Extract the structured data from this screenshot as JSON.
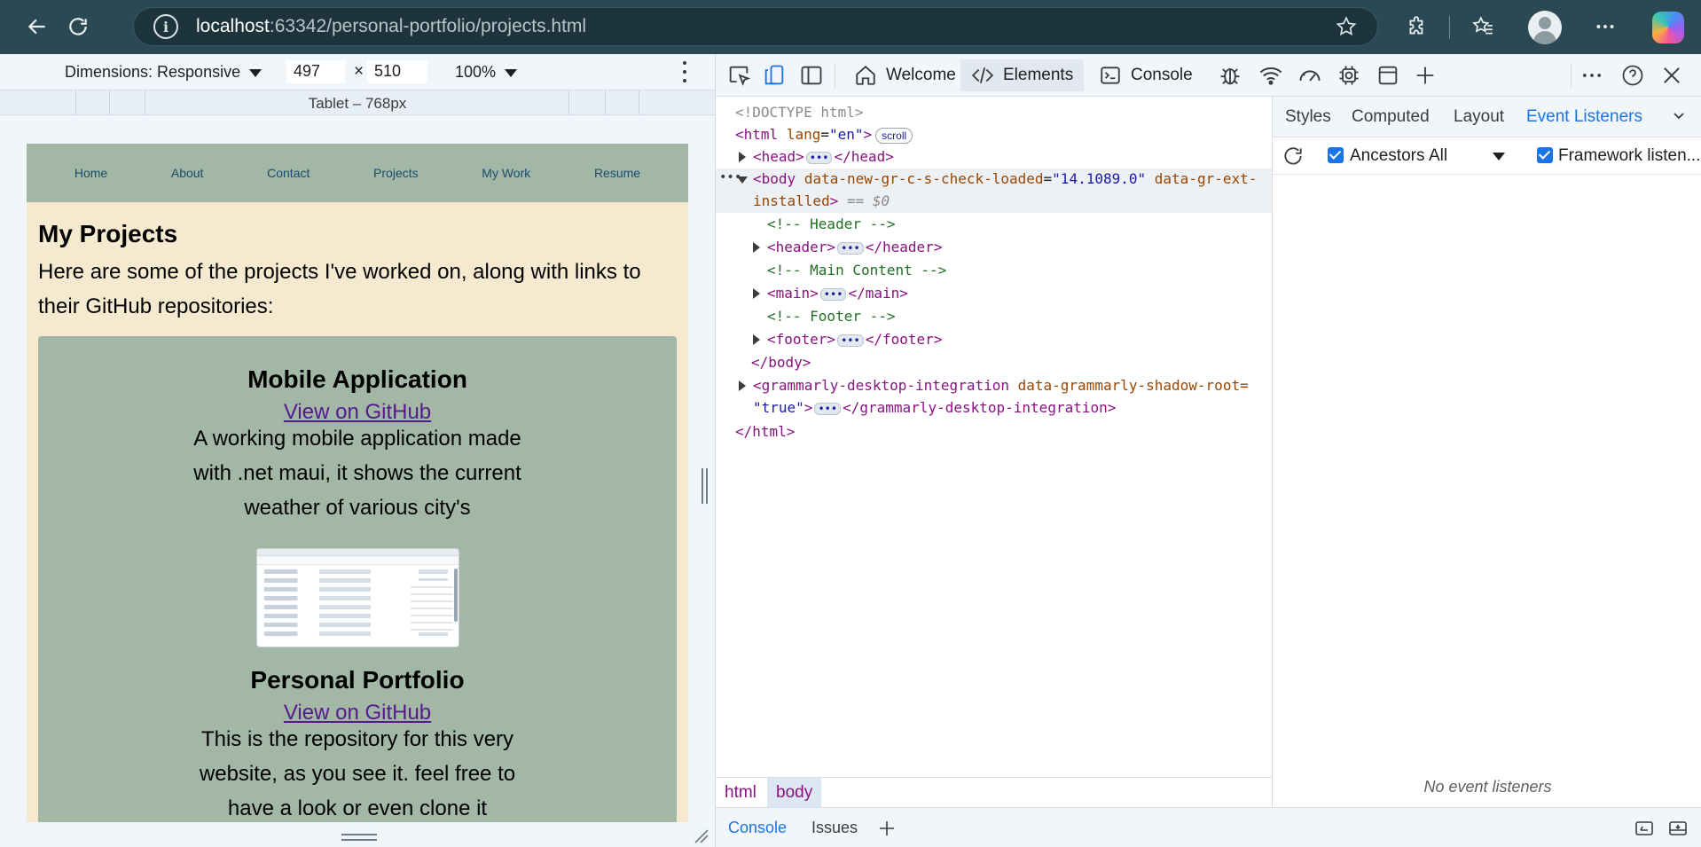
{
  "browser": {
    "url_host": "localhost",
    "url_rest": ":63342/personal-portfolio/projects.html"
  },
  "device_toolbar": {
    "dimensions_label": "Dimensions: Responsive",
    "width": "497",
    "height": "510",
    "times": "×",
    "zoom": "100%",
    "media_query_label": "Tablet – 768px"
  },
  "site": {
    "nav": [
      "Home",
      "About",
      "Contact",
      "Projects",
      "My Work",
      "Resume"
    ],
    "heading": "My Projects",
    "intro": "Here are some of the projects I've worked on, along with links to their GitHub repositories:",
    "projects": [
      {
        "title": "Mobile Application",
        "link": "View on GitHub",
        "description": "A working mobile application made with .net maui, it shows the current weather of various city's"
      },
      {
        "title": "Personal Portfolio",
        "link": "View on GitHub",
        "description": "This is the repository for this very website, as you see it. feel free to have a look or even clone it"
      }
    ]
  },
  "devtools": {
    "tabs": [
      "Welcome",
      "Elements",
      "Console"
    ],
    "selected_tab": "Elements",
    "dom": {
      "doctype": "<!DOCTYPE html>",
      "html_open": "<html",
      "html_lang_attr": "lang",
      "html_lang_val": "\"en\"",
      "scroll_badge": "scroll",
      "head": "<head>",
      "head_close": "</head>",
      "body_open": "<body",
      "body_attr1": "data-new-gr-c-s-check-loaded",
      "body_val1": "\"14.1089.0\"",
      "body_attr2a": "data-gr-ext-",
      "body_attr2b": "installed",
      "eq0": "== $0",
      "comment_header": "<!-- Header -->",
      "header": "<header>",
      "header_close": "</header>",
      "comment_main": "<!-- Main Content -->",
      "main": "<main>",
      "main_close": "</main>",
      "comment_footer": "<!-- Footer -->",
      "footer": "<footer>",
      "footer_close": "</footer>",
      "body_close": "</body>",
      "gram_open": "<grammarly-desktop-integration",
      "gram_attr": "data-grammarly-shadow-root=",
      "gram_val": "\"true\"",
      "gram_close": "</grammarly-desktop-integration>",
      "html_close": "</html>"
    },
    "breadcrumbs": [
      "html",
      "body"
    ],
    "side_tabs": [
      "Styles",
      "Computed",
      "Layout",
      "Event Listeners"
    ],
    "side_selected": "Event Listeners",
    "ancestors_label": "Ancestors",
    "filter_value": "All",
    "framework_label": "Framework listen...",
    "no_listeners": "No event listeners",
    "drawer_tabs": [
      "Console",
      "Issues"
    ]
  }
}
